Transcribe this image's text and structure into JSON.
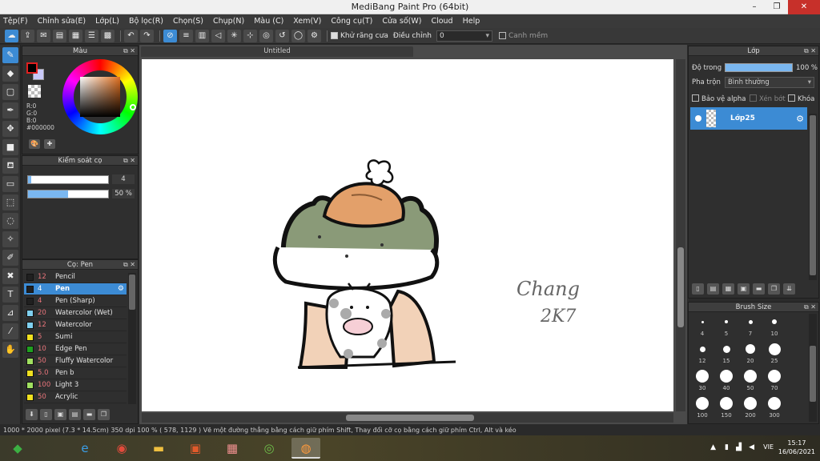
{
  "window": {
    "title": "MediBang Paint Pro (64bit)",
    "min": "–",
    "max": "❐",
    "close": "✕"
  },
  "menu": [
    "Tệp(F)",
    "Chỉnh sửa(E)",
    "Lớp(L)",
    "Bộ lọc(R)",
    "Chọn(S)",
    "Chụp(N)",
    "Màu (C)",
    "Xem(V)",
    "Công cụ(T)",
    "Cửa số(W)",
    "Cloud",
    "Help"
  ],
  "toolbar": {
    "antialias_label": "Khử răng cưa",
    "adjust_label": "Điều chỉnh",
    "adjust_value": "0",
    "canh_mem_label": "Canh mềm"
  },
  "color_panel": {
    "title": "Màu",
    "r": "R:0",
    "g": "G:0",
    "b": "B:0",
    "hex": "#000000"
  },
  "brush_control": {
    "title": "Kiểm soát cọ",
    "size_value": "4",
    "opacity_value": "50 %",
    "size_fraction": 0.04,
    "opacity_fraction": 0.5
  },
  "brush_list": {
    "title": "Cọ: Pen",
    "items": [
      {
        "size": "12",
        "name": "Pencil",
        "color": "#202020"
      },
      {
        "size": "4",
        "name": "Pen",
        "color": "#202020",
        "selected": true
      },
      {
        "size": "4",
        "name": "Pen (Sharp)",
        "color": "#202020"
      },
      {
        "size": "20",
        "name": "Watercolor (Wet)",
        "color": "#7fd0f0"
      },
      {
        "size": "12",
        "name": "Watercolor",
        "color": "#7fd0f0"
      },
      {
        "size": "5",
        "name": "Sumi",
        "color": "#f0e020"
      },
      {
        "size": "10",
        "name": "Edge Pen",
        "color": "#20a020"
      },
      {
        "size": "50",
        "name": "Fluffy Watercolor",
        "color": "#a0e060"
      },
      {
        "size": "5.0",
        "name": "Pen b",
        "color": "#f0e020"
      },
      {
        "size": "100",
        "name": "Light 3",
        "color": "#a0e060"
      },
      {
        "size": "50",
        "name": "Acrylic",
        "color": "#f0e020"
      }
    ]
  },
  "document": {
    "tab": "Untitled",
    "signature_line1": "Chang",
    "signature_line2": "2K7"
  },
  "layer_panel": {
    "title": "Lớp",
    "opacity_label": "Độ trong",
    "opacity_value": "100 %",
    "blend_label": "Pha trộn",
    "blend_value": "Bình thường",
    "protect_alpha": "Bảo vệ alpha",
    "clipping": "Xén bớt",
    "lock": "Khóa",
    "layer_name": "Lớp25"
  },
  "brush_size_panel": {
    "title": "Brush Size",
    "sizes": [
      "4",
      "5",
      "7",
      "10",
      "12",
      "15",
      "20",
      "25",
      "30",
      "40",
      "50",
      "70",
      "100",
      "150",
      "200",
      "300"
    ]
  },
  "status": {
    "text": "1000 * 2000 pixel   (7.3 * 14.5cm)   350 dpi   100 %   ( 578, 1129 )   Vẽ một đường thẳng bằng cách giữ phím Shift, Thay đổi cỡ cọ bằng cách giữ phím Ctrl, Alt và kéo"
  },
  "taskbar": {
    "lang": "VIE",
    "time": "15:17",
    "date": "16/06/2021"
  }
}
